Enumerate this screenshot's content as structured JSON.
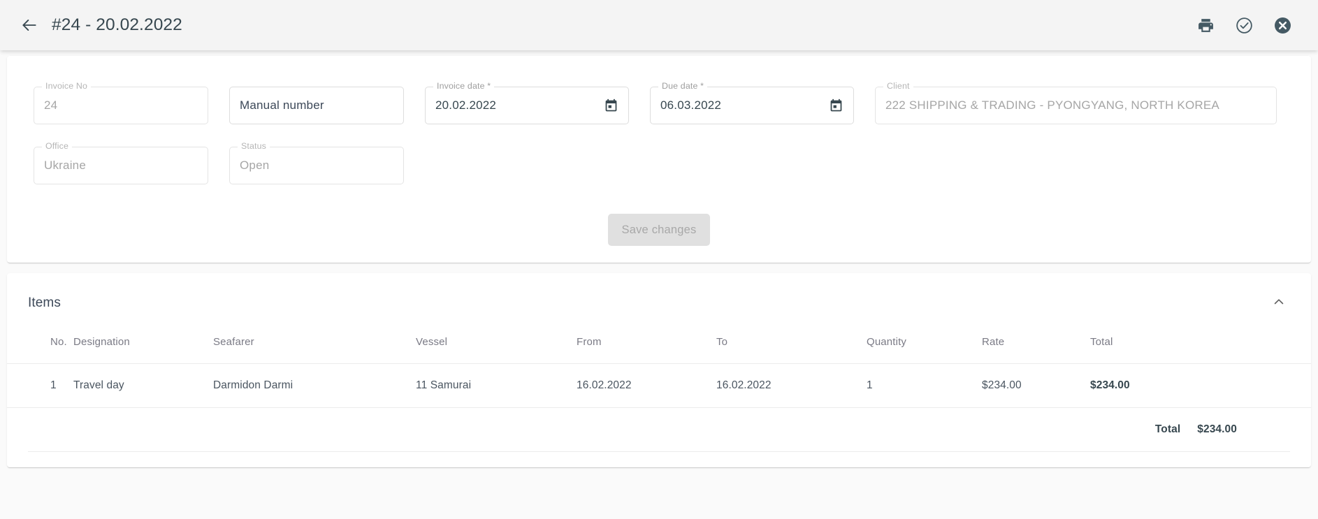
{
  "appbar": {
    "back_icon": "arrow-left-icon",
    "title": "#24 - 20.02.2022",
    "actions": [
      {
        "name": "print-button",
        "icon": "printer-icon"
      },
      {
        "name": "approve-button",
        "icon": "check-circle-icon"
      },
      {
        "name": "close-button",
        "icon": "x-circle-icon"
      }
    ]
  },
  "form": {
    "invoice_no": {
      "label": "Invoice No",
      "value": "24",
      "disabled": true
    },
    "manual_number": {
      "label": "",
      "value": "Manual number",
      "placeholder": "Manual number",
      "disabled": false
    },
    "invoice_date": {
      "label": "Invoice date *",
      "value": "20.02.2022",
      "icon": "calendar-icon",
      "disabled": false
    },
    "due_date": {
      "label": "Due date *",
      "value": "06.03.2022",
      "icon": "calendar-icon",
      "disabled": false
    },
    "client": {
      "label": "Client",
      "value": "222 SHIPPING & TRADING - PYONGYANG, NORTH KOREA",
      "disabled": true
    },
    "office": {
      "label": "Office",
      "value": "Ukraine",
      "disabled": true
    },
    "status": {
      "label": "Status",
      "value": "Open",
      "disabled": true
    },
    "save_label": "Save changes"
  },
  "items": {
    "title": "Items",
    "collapse_icon": "chevron-up-icon",
    "columns": [
      "No.",
      "Designation",
      "Seafarer",
      "Vessel",
      "From",
      "To",
      "Quantity",
      "Rate",
      "Total"
    ],
    "rows": [
      {
        "no": "1",
        "designation": "Travel day",
        "seafarer": "Darmidon Darmi",
        "vessel": "11 Samurai",
        "from": "16.02.2022",
        "to": "16.02.2022",
        "quantity": "1",
        "rate": "$234.00",
        "total": "$234.00"
      }
    ],
    "total_label": "Total",
    "total_value": "$234.00"
  },
  "colors": {
    "appbar_bg": "#f4f4f4",
    "page_bg": "#fafafa",
    "card_bg": "#ffffff",
    "text_primary": "#37474f",
    "text_muted": "#9e9e9e",
    "icon_dark": "#455a64",
    "disabled_button_bg": "#e0e0e0"
  }
}
